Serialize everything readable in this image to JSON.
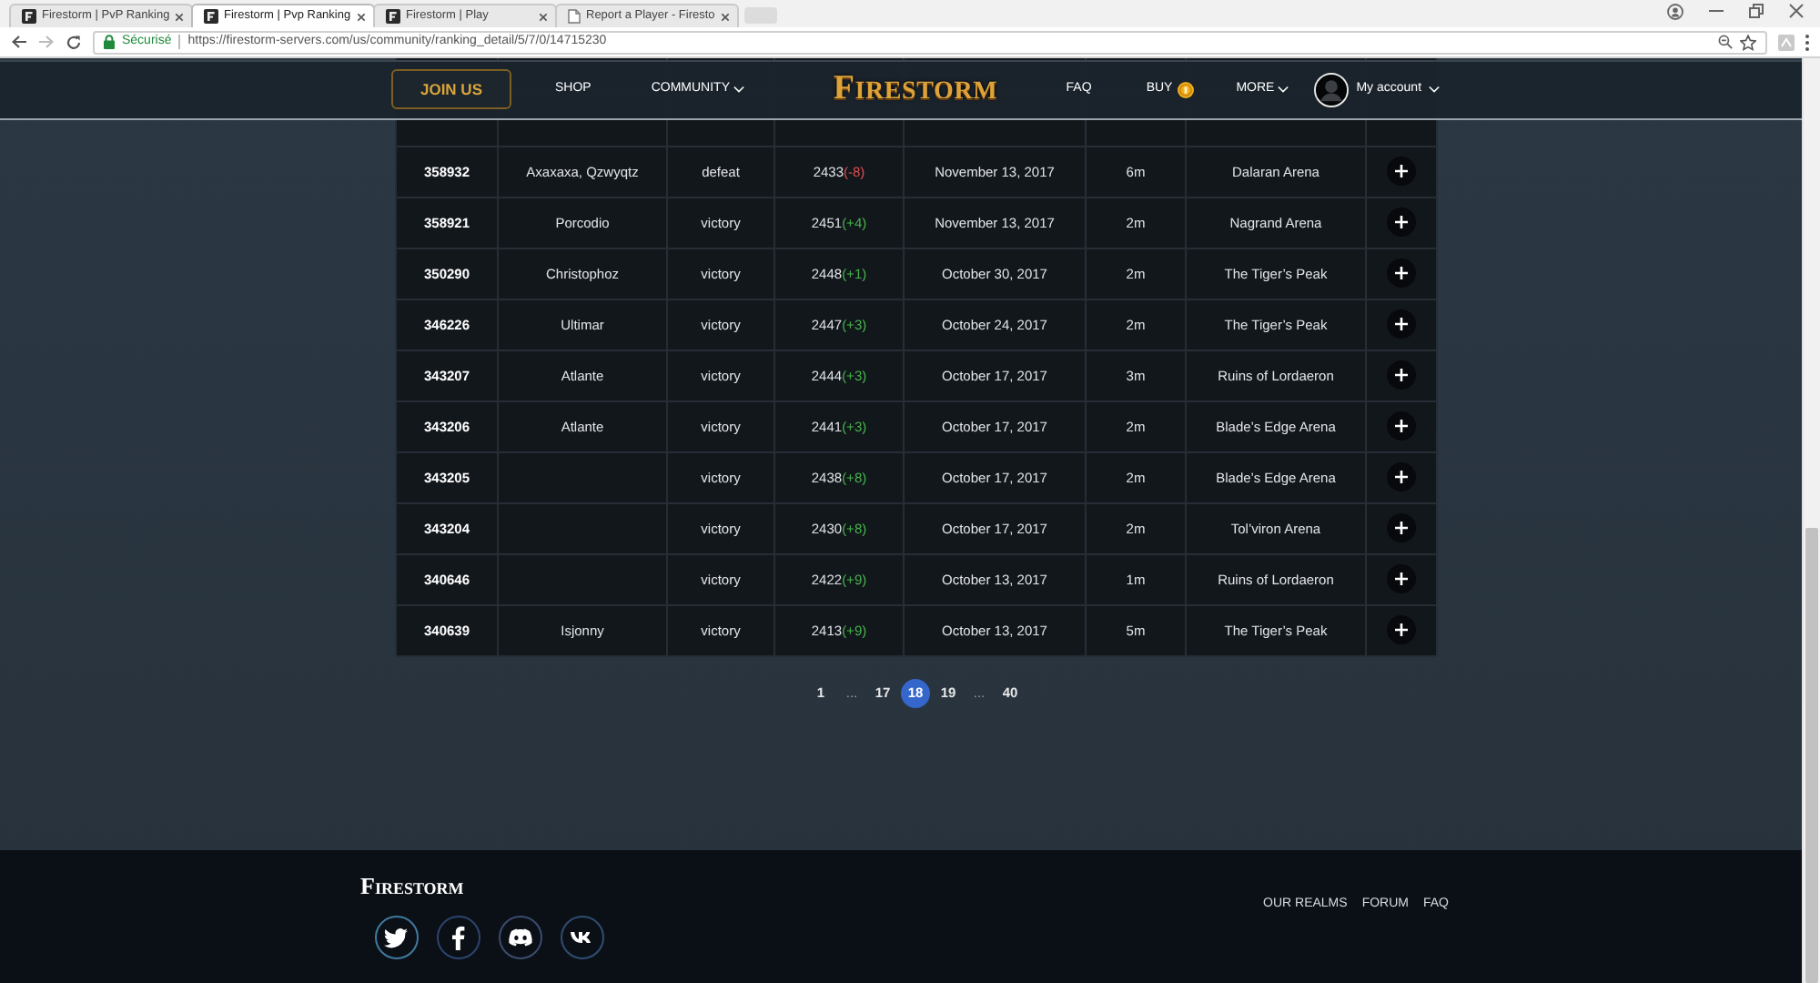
{
  "browser": {
    "tabs": [
      {
        "title": "Firestorm | PvP Ranking",
        "kind": "site",
        "selected": false
      },
      {
        "title": "Firestorm | Pvp Ranking",
        "kind": "site",
        "selected": true
      },
      {
        "title": "Firestorm | Play",
        "kind": "site",
        "selected": false
      },
      {
        "title": "Report a Player - Firesto",
        "kind": "page",
        "selected": false
      }
    ],
    "security": "Sécurisé",
    "url": "https://firestorm-servers.com/us/community/ranking_detail/5/7/0/14715230"
  },
  "nav": {
    "join_button": "JOIN US",
    "left_links": [
      {
        "label": "SHOP",
        "kind": "plain"
      },
      {
        "label": "COMMUNITY",
        "kind": "dropdown"
      }
    ],
    "logo": "FIRESTORM",
    "right_links": [
      {
        "label": "FAQ",
        "kind": "plain"
      },
      {
        "label": "BUY",
        "kind": "coin"
      },
      {
        "label": "MORE",
        "kind": "dropdown"
      }
    ],
    "account": "My account"
  },
  "table": {
    "rows": [
      {
        "id": "358932",
        "players": "Axaxaxa, Qzwyqtz",
        "result": "defeat",
        "rating": "2433",
        "change": "(-8)",
        "loss": true,
        "date": "November 13, 2017",
        "duration": "6m",
        "arena": "Dalaran Arena"
      },
      {
        "id": "358921",
        "players": "Porcodio",
        "result": "victory",
        "rating": "2451",
        "change": "(+4)",
        "loss": false,
        "date": "November 13, 2017",
        "duration": "2m",
        "arena": "Nagrand Arena"
      },
      {
        "id": "350290",
        "players": "Christophoz",
        "result": "victory",
        "rating": "2448",
        "change": "(+1)",
        "loss": false,
        "date": "October 30, 2017",
        "duration": "2m",
        "arena": "The Tiger’s Peak"
      },
      {
        "id": "346226",
        "players": "Ultimar",
        "result": "victory",
        "rating": "2447",
        "change": "(+3)",
        "loss": false,
        "date": "October 24, 2017",
        "duration": "2m",
        "arena": "The Tiger’s Peak"
      },
      {
        "id": "343207",
        "players": "Atlante",
        "result": "victory",
        "rating": "2444",
        "change": "(+3)",
        "loss": false,
        "date": "October 17, 2017",
        "duration": "3m",
        "arena": "Ruins of Lordaeron"
      },
      {
        "id": "343206",
        "players": "Atlante",
        "result": "victory",
        "rating": "2441",
        "change": "(+3)",
        "loss": false,
        "date": "October 17, 2017",
        "duration": "2m",
        "arena": "Blade’s Edge Arena"
      },
      {
        "id": "343205",
        "result": "victory",
        "rating": "2438",
        "change": "(+8)",
        "loss": false,
        "date": "October 17, 2017",
        "duration": "2m",
        "arena": "Blade’s Edge Arena"
      },
      {
        "id": "343204",
        "result": "victory",
        "rating": "2430",
        "change": "(+8)",
        "loss": false,
        "date": "October 17, 2017",
        "duration": "2m",
        "arena": "Tol’viron Arena"
      },
      {
        "id": "340646",
        "result": "victory",
        "rating": "2422",
        "change": "(+9)",
        "loss": false,
        "date": "October 13, 2017",
        "duration": "1m",
        "arena": "Ruins of Lordaeron"
      },
      {
        "id": "340639",
        "players": "Isjonny",
        "result": "victory",
        "rating": "2413",
        "change": "(+9)",
        "loss": false,
        "date": "October 13, 2017",
        "duration": "5m",
        "arena": "The Tiger’s Peak"
      }
    ]
  },
  "pagination": [
    {
      "label": "1",
      "kind": "page",
      "selected": false
    },
    {
      "label": "...",
      "kind": "gap"
    },
    {
      "label": "17",
      "kind": "page",
      "selected": false
    },
    {
      "label": "18",
      "kind": "page",
      "selected": true
    },
    {
      "label": "19",
      "kind": "page",
      "selected": false
    },
    {
      "label": "...",
      "kind": "gap"
    },
    {
      "label": "40",
      "kind": "page",
      "selected": false
    }
  ],
  "footer": {
    "logo": "FIRESTORM",
    "social": [
      {
        "kind": "twitter"
      },
      {
        "kind": "facebook"
      },
      {
        "kind": "discord"
      },
      {
        "kind": "vk"
      }
    ],
    "links": [
      "OUR REALMS",
      "FORUM",
      "FAQ"
    ]
  }
}
